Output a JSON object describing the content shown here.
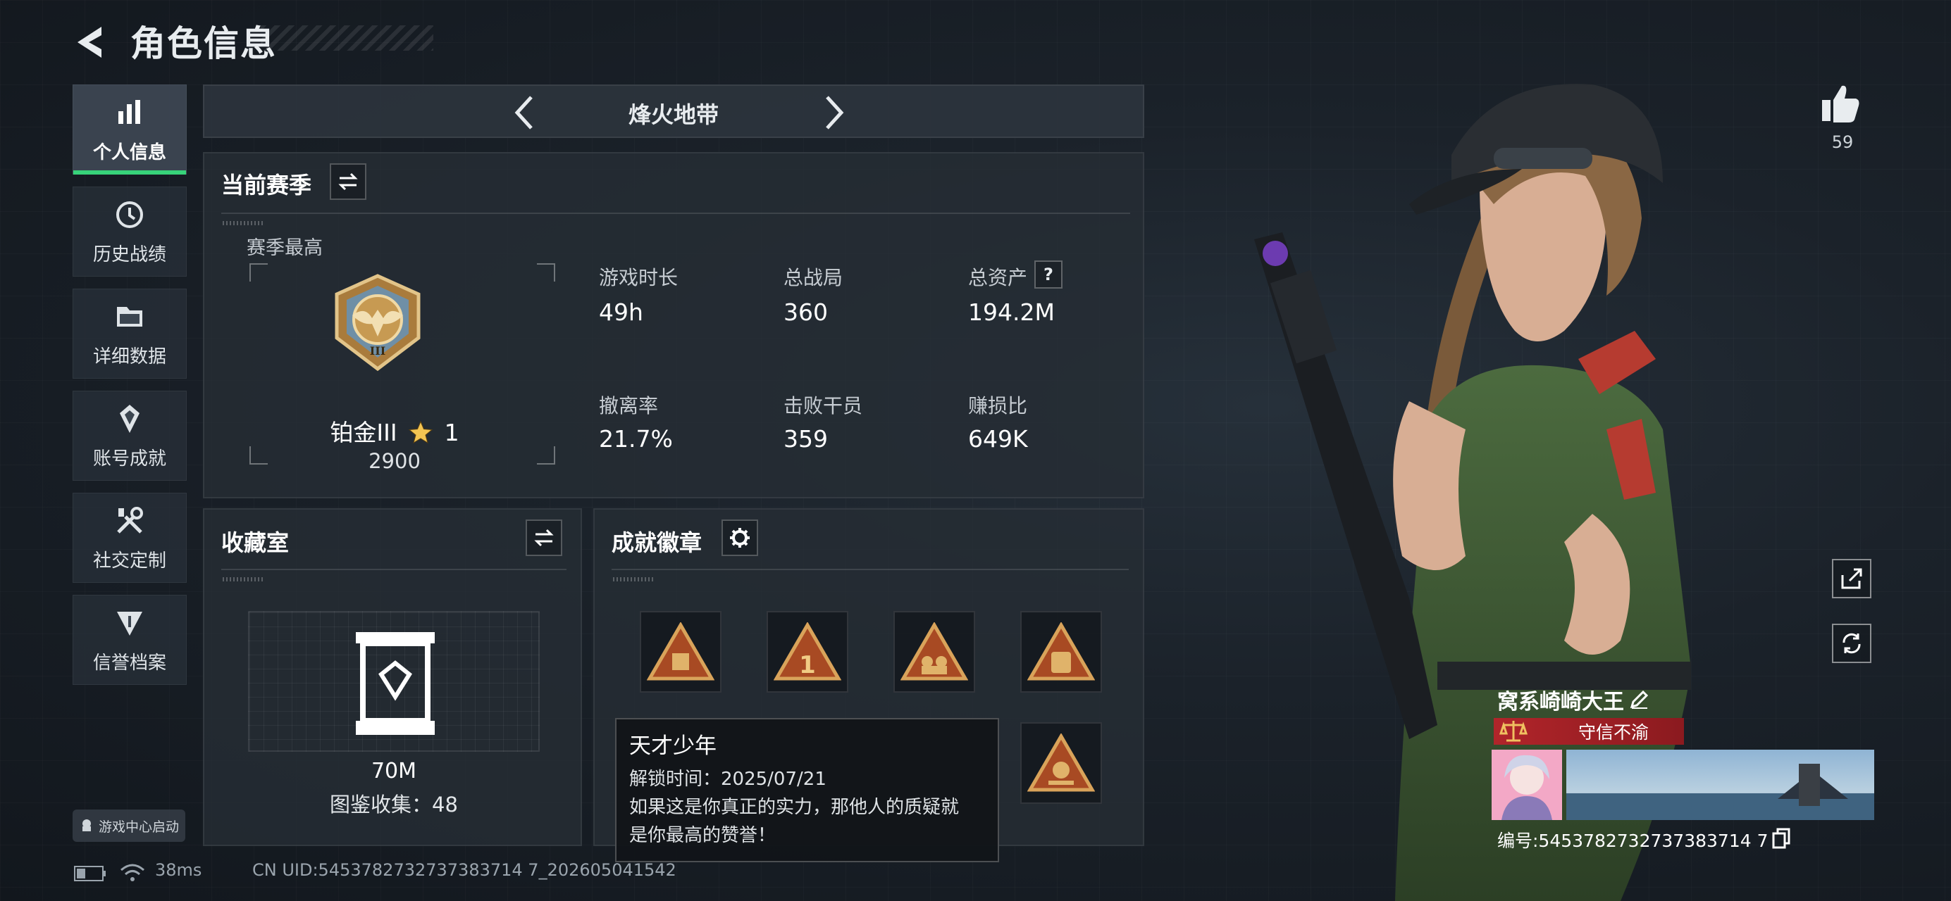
{
  "header": {
    "title": "角色信息"
  },
  "sidebar": {
    "items": [
      {
        "label": "个人信息",
        "icon": "bar-chart-icon",
        "active": true
      },
      {
        "label": "历史战绩",
        "icon": "history-icon",
        "active": false
      },
      {
        "label": "详细数据",
        "icon": "folder-icon",
        "active": false
      },
      {
        "label": "账号成就",
        "icon": "achievement-icon",
        "active": false
      },
      {
        "label": "社交定制",
        "icon": "tools-icon",
        "active": false
      },
      {
        "label": "信誉档案",
        "icon": "credit-shield-icon",
        "active": false
      }
    ],
    "game_center": "游戏中心启动"
  },
  "mode": {
    "name": "烽火地带"
  },
  "season": {
    "title": "当前赛季",
    "best_label": "赛季最高",
    "rank_name": "铂金III",
    "rank_stars": "1",
    "rank_score": "2900",
    "rank_roman": "III",
    "stats": [
      {
        "label": "游戏时长",
        "value": "49h"
      },
      {
        "label": "总战局",
        "value": "360"
      },
      {
        "label": "总资产",
        "value": "194.2M"
      },
      {
        "label": "撤离率",
        "value": "21.7%"
      },
      {
        "label": "击败干员",
        "value": "359"
      },
      {
        "label": "赚损比",
        "value": "649K"
      }
    ],
    "help_mark": "?"
  },
  "collection": {
    "title": "收藏室",
    "value": "70M",
    "dex_label": "图鉴收集：48"
  },
  "achievements": {
    "title": "成就徽章",
    "badge_glyph": "1"
  },
  "tooltip": {
    "title": "天才少年",
    "unlock": "解锁时间：2025/07/21",
    "desc_line1": "如果这是你真正的实力，那他人的质疑就",
    "desc_line2": "是你最高的赞誉！"
  },
  "status": {
    "ping": "38ms",
    "uid": "CN UID:5453782732737383714 7_202605041542"
  },
  "profile": {
    "likes": "59",
    "nickname": "窝系崎崎大王",
    "credit": "守信不渝",
    "uid": "编号:5453782732737383714 7"
  },
  "colors": {
    "accent": "#37d37a",
    "credit_red": "#b1252a",
    "gold": "#c79a52"
  }
}
